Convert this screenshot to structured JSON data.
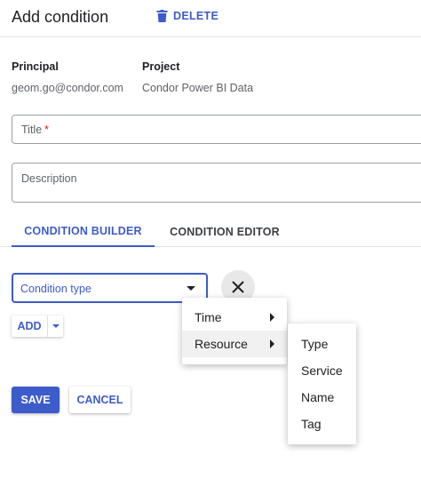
{
  "header": {
    "title": "Add condition",
    "delete_label": "DELETE"
  },
  "info": {
    "principal_label": "Principal",
    "principal_value": "geom.go@condor.com",
    "project_label": "Project",
    "project_value": "Condor Power BI Data"
  },
  "form": {
    "title_label": "Title",
    "title_required_mark": "*",
    "description_label": "Description"
  },
  "tabs": {
    "builder": "CONDITION BUILDER",
    "editor": "CONDITION EDITOR",
    "active": "builder"
  },
  "builder": {
    "condition_type_placeholder": "Condition type",
    "add_label": "ADD"
  },
  "menu": {
    "items": [
      {
        "label": "Time",
        "has_submenu": true
      },
      {
        "label": "Resource",
        "has_submenu": true,
        "active": true
      }
    ],
    "submenu": {
      "items": [
        "Type",
        "Service",
        "Name",
        "Tag"
      ]
    }
  },
  "actions": {
    "save_label": "SAVE",
    "cancel_label": "CANCEL"
  },
  "colors": {
    "accent": "#3c5cc9",
    "required": "#c5221f",
    "text": "#202124",
    "muted": "#5f6368"
  },
  "icons": {
    "delete": "trash-icon",
    "close": "close-icon",
    "dropdown": "caret-down-icon",
    "submenu": "caret-right-icon"
  }
}
